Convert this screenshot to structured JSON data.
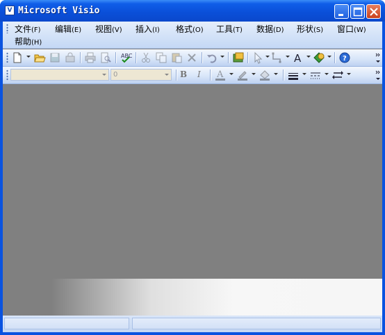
{
  "window": {
    "title": "Microsoft Visio",
    "app_icon_glyph": "V",
    "controls": [
      "minimize-icon",
      "maximize-icon",
      "close-icon"
    ]
  },
  "menubar": {
    "items": [
      {
        "label": "文件",
        "accel": "(F)"
      },
      {
        "label": "编辑",
        "accel": "(E)"
      },
      {
        "label": "视图",
        "accel": "(V)"
      },
      {
        "label": "插入",
        "accel": "(I)"
      },
      {
        "label": "格式",
        "accel": "(O)"
      },
      {
        "label": "工具",
        "accel": "(T)"
      },
      {
        "label": "数据",
        "accel": "(D)"
      },
      {
        "label": "形状",
        "accel": "(S)"
      },
      {
        "label": "窗口",
        "accel": "(W)"
      },
      {
        "label": "帮助",
        "accel": "(H)"
      }
    ]
  },
  "standard_toolbar": {
    "icons": [
      "new-icon",
      "open-icon",
      "save-icon",
      "permission-icon",
      "print-icon",
      "print-preview-icon",
      "spelling-icon",
      "cut-icon",
      "copy-icon",
      "paste-icon",
      "delete-icon",
      "undo-icon",
      "shapes-icon",
      "pointer-tool-icon",
      "connector-tool-icon",
      "text-tool-icon",
      "shape-tool-icon",
      "help-icon"
    ]
  },
  "formatting_toolbar": {
    "font_name_value": "",
    "font_size_value": "0",
    "bold_label": "B",
    "italic_label": "I",
    "icons": [
      "font-color-icon",
      "line-color-icon",
      "fill-color-icon",
      "line-weight-icon",
      "line-pattern-icon",
      "line-ends-icon"
    ]
  },
  "colors": {
    "titlebar": "#0a4fd8",
    "workspace": "#808080",
    "toolbar": "#d9e6f9"
  }
}
